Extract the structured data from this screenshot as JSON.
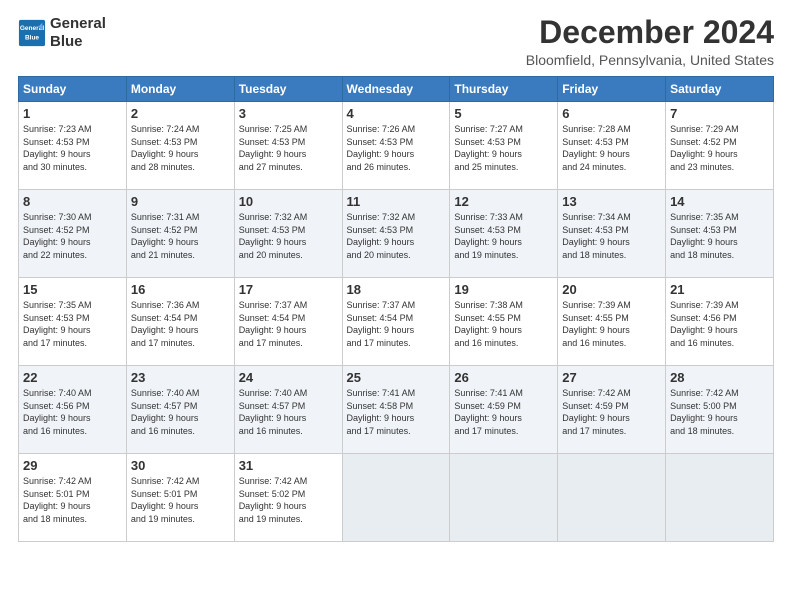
{
  "logo": {
    "line1": "General",
    "line2": "Blue"
  },
  "title": "December 2024",
  "subtitle": "Bloomfield, Pennsylvania, United States",
  "weekdays": [
    "Sunday",
    "Monday",
    "Tuesday",
    "Wednesday",
    "Thursday",
    "Friday",
    "Saturday"
  ],
  "weeks": [
    [
      {
        "day": 1,
        "sunrise": "7:23 AM",
        "sunset": "4:53 PM",
        "daylight": "9 hours and 30 minutes."
      },
      {
        "day": 2,
        "sunrise": "7:24 AM",
        "sunset": "4:53 PM",
        "daylight": "9 hours and 28 minutes."
      },
      {
        "day": 3,
        "sunrise": "7:25 AM",
        "sunset": "4:53 PM",
        "daylight": "9 hours and 27 minutes."
      },
      {
        "day": 4,
        "sunrise": "7:26 AM",
        "sunset": "4:53 PM",
        "daylight": "9 hours and 26 minutes."
      },
      {
        "day": 5,
        "sunrise": "7:27 AM",
        "sunset": "4:53 PM",
        "daylight": "9 hours and 25 minutes."
      },
      {
        "day": 6,
        "sunrise": "7:28 AM",
        "sunset": "4:53 PM",
        "daylight": "9 hours and 24 minutes."
      },
      {
        "day": 7,
        "sunrise": "7:29 AM",
        "sunset": "4:52 PM",
        "daylight": "9 hours and 23 minutes."
      }
    ],
    [
      {
        "day": 8,
        "sunrise": "7:30 AM",
        "sunset": "4:52 PM",
        "daylight": "9 hours and 22 minutes."
      },
      {
        "day": 9,
        "sunrise": "7:31 AM",
        "sunset": "4:52 PM",
        "daylight": "9 hours and 21 minutes."
      },
      {
        "day": 10,
        "sunrise": "7:32 AM",
        "sunset": "4:53 PM",
        "daylight": "9 hours and 20 minutes."
      },
      {
        "day": 11,
        "sunrise": "7:32 AM",
        "sunset": "4:53 PM",
        "daylight": "9 hours and 20 minutes."
      },
      {
        "day": 12,
        "sunrise": "7:33 AM",
        "sunset": "4:53 PM",
        "daylight": "9 hours and 19 minutes."
      },
      {
        "day": 13,
        "sunrise": "7:34 AM",
        "sunset": "4:53 PM",
        "daylight": "9 hours and 18 minutes."
      },
      {
        "day": 14,
        "sunrise": "7:35 AM",
        "sunset": "4:53 PM",
        "daylight": "9 hours and 18 minutes."
      }
    ],
    [
      {
        "day": 15,
        "sunrise": "7:35 AM",
        "sunset": "4:53 PM",
        "daylight": "9 hours and 17 minutes."
      },
      {
        "day": 16,
        "sunrise": "7:36 AM",
        "sunset": "4:54 PM",
        "daylight": "9 hours and 17 minutes."
      },
      {
        "day": 17,
        "sunrise": "7:37 AM",
        "sunset": "4:54 PM",
        "daylight": "9 hours and 17 minutes."
      },
      {
        "day": 18,
        "sunrise": "7:37 AM",
        "sunset": "4:54 PM",
        "daylight": "9 hours and 17 minutes."
      },
      {
        "day": 19,
        "sunrise": "7:38 AM",
        "sunset": "4:55 PM",
        "daylight": "9 hours and 16 minutes."
      },
      {
        "day": 20,
        "sunrise": "7:39 AM",
        "sunset": "4:55 PM",
        "daylight": "9 hours and 16 minutes."
      },
      {
        "day": 21,
        "sunrise": "7:39 AM",
        "sunset": "4:56 PM",
        "daylight": "9 hours and 16 minutes."
      }
    ],
    [
      {
        "day": 22,
        "sunrise": "7:40 AM",
        "sunset": "4:56 PM",
        "daylight": "9 hours and 16 minutes."
      },
      {
        "day": 23,
        "sunrise": "7:40 AM",
        "sunset": "4:57 PM",
        "daylight": "9 hours and 16 minutes."
      },
      {
        "day": 24,
        "sunrise": "7:40 AM",
        "sunset": "4:57 PM",
        "daylight": "9 hours and 16 minutes."
      },
      {
        "day": 25,
        "sunrise": "7:41 AM",
        "sunset": "4:58 PM",
        "daylight": "9 hours and 17 minutes."
      },
      {
        "day": 26,
        "sunrise": "7:41 AM",
        "sunset": "4:59 PM",
        "daylight": "9 hours and 17 minutes."
      },
      {
        "day": 27,
        "sunrise": "7:42 AM",
        "sunset": "4:59 PM",
        "daylight": "9 hours and 17 minutes."
      },
      {
        "day": 28,
        "sunrise": "7:42 AM",
        "sunset": "5:00 PM",
        "daylight": "9 hours and 18 minutes."
      }
    ],
    [
      {
        "day": 29,
        "sunrise": "7:42 AM",
        "sunset": "5:01 PM",
        "daylight": "9 hours and 18 minutes."
      },
      {
        "day": 30,
        "sunrise": "7:42 AM",
        "sunset": "5:01 PM",
        "daylight": "9 hours and 19 minutes."
      },
      {
        "day": 31,
        "sunrise": "7:42 AM",
        "sunset": "5:02 PM",
        "daylight": "9 hours and 19 minutes."
      },
      null,
      null,
      null,
      null
    ]
  ]
}
